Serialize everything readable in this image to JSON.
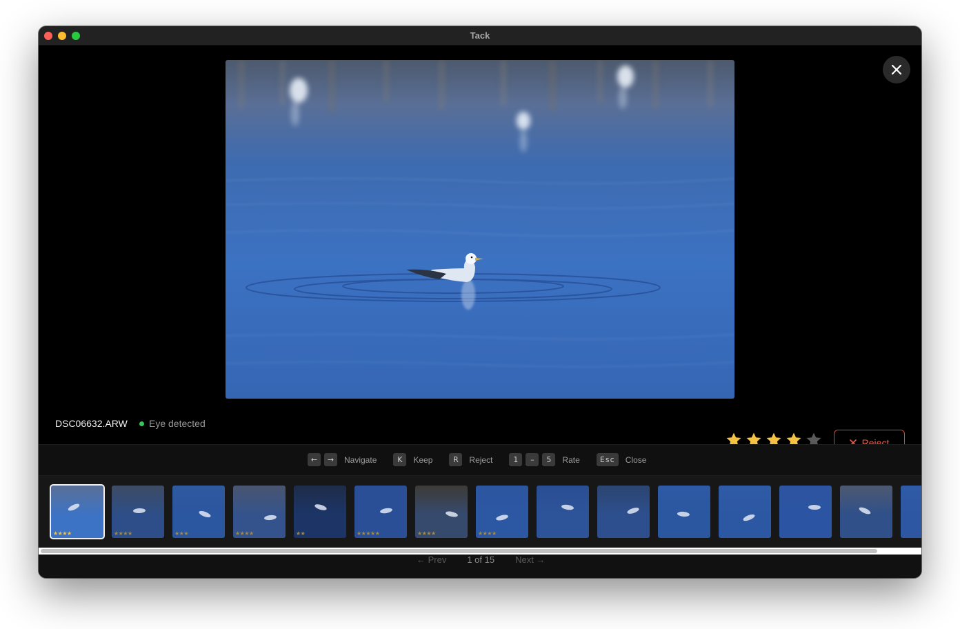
{
  "window": {
    "title": "Tack"
  },
  "photo": {
    "filename": "DSC06632.ARW",
    "status": "Eye detected",
    "rating": 4,
    "max_rating": 5
  },
  "actions": {
    "reject_label": "Reject",
    "reject_icon": "x-icon",
    "close_icon": "close-icon"
  },
  "shortcuts": {
    "navigate_keys": [
      "←",
      "→"
    ],
    "navigate_label": "Navigate",
    "keep_key": "K",
    "keep_label": "Keep",
    "reject_key": "R",
    "reject_label": "Reject",
    "rate_key_from": "1",
    "rate_key_sep": "–",
    "rate_key_to": "5",
    "rate_label": "Rate",
    "close_key": "Esc",
    "close_label": "Close"
  },
  "filmstrip": {
    "thumbnails": [
      {
        "stars": "★★★★",
        "active": true
      },
      {
        "stars": "★★★★"
      },
      {
        "stars": "★★★"
      },
      {
        "stars": "★★★★"
      },
      {
        "stars": "★★"
      },
      {
        "stars": "★★★★★"
      },
      {
        "stars": "★★★★"
      },
      {
        "stars": "★★★★"
      },
      {
        "stars": ""
      },
      {
        "stars": ""
      },
      {
        "stars": ""
      },
      {
        "stars": ""
      },
      {
        "stars": ""
      },
      {
        "stars": ""
      },
      {
        "stars": ""
      }
    ]
  },
  "pager": {
    "prev_label": "← Prev",
    "position": "1 of 15",
    "next_label": "Next →"
  },
  "colors": {
    "accent_star": "#f6c244",
    "star_empty": "#5a5a5a",
    "reject_red": "#ef5a4e",
    "status_green": "#34c759"
  }
}
